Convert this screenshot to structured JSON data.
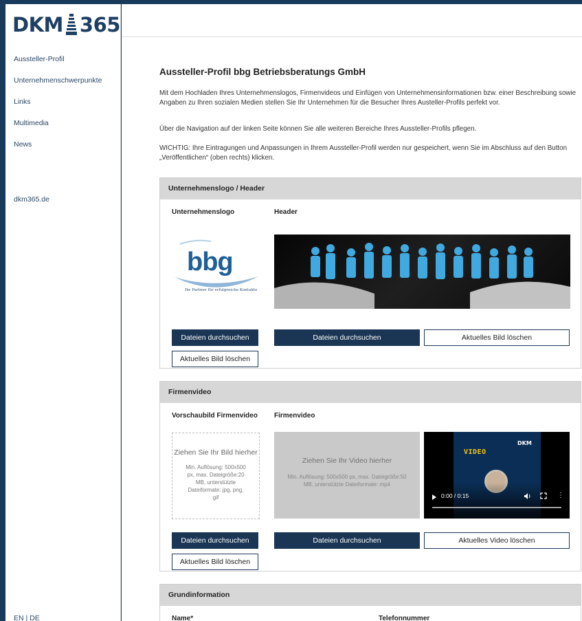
{
  "brand": {
    "logo_text_left": "DKM",
    "logo_text_right": "365"
  },
  "sidebar": {
    "nav": [
      {
        "label": "Aussteller-Profil"
      },
      {
        "label": "Unternehmenschwerpunkte"
      },
      {
        "label": "Links"
      },
      {
        "label": "Multimedia"
      },
      {
        "label": "News"
      }
    ],
    "site_link": "dkm365.de",
    "language": "EN | DE"
  },
  "page": {
    "title": "Aussteller-Profil bbg Betriebsberatungs GmbH",
    "intro_1": "Mit dem Hochladen Ihres Unternehmenslogos, Firmenvideos und Einfügen von Unternehmensinformationen bzw. einer Beschreibung sowie Angaben zu Ihren sozialen Medien stellen Sie Ihr Unternehmen für die Besucher Ihres Austeller-Profils perfekt vor.",
    "intro_2": "Über die Navigation auf der linken Seite können Sie alle weiteren Bereiche Ihres Aussteller-Profils pflegen.",
    "intro_3": "WICHTIG: Ihre Eintragungen und Anpassungen in Ihrem Aussteller-Profil werden nur gespeichert, wenn Sie im Abschluss auf den Button „Veröffentlichen“ (oben rechts) klicken."
  },
  "logo_panel": {
    "heading": "Unternehmenslogo / Header",
    "logo_label": "Unternehmenslogo",
    "header_label": "Header",
    "company_logo_text": "bbg",
    "company_tagline": "Ihr Partner für erfolgreiche Kontakte",
    "browse_label": "Dateien durchsuchen",
    "delete_image_label": "Aktuelles Bild löschen"
  },
  "video_panel": {
    "heading": "Firmenvideo",
    "thumb_label": "Vorschaubild Firmenvideo",
    "video_label": "Firmenvideo",
    "image_drop_title": "Ziehen Sie Ihr Bild hierher",
    "image_drop_hint": "Min. Auflösung: 500x500 px, max. Dateigröße:20 MB, unterstützte Dateiformate: jpg, png, gif",
    "video_drop_title": "Ziehen Sie Ihr Video hierher",
    "video_drop_hint": "Min. Auflösung: 500x500 px, max. Dateigröße:50 MB, unterstützte Dateiformate: mp4",
    "browse_label": "Dateien durchsuchen",
    "delete_image_label": "Aktuelles Bild löschen",
    "delete_video_label": "Aktuelles Video löschen",
    "player": {
      "brand": "DKM",
      "title": "VIDEO",
      "time": "0:00 / 0:15"
    }
  },
  "basic_panel": {
    "heading": "Grundinformation",
    "name_label": "Name*",
    "phone_label": "Telefonnummer"
  },
  "colors": {
    "navy": "#1a3654",
    "frame": "#193a5a",
    "panel_head": "#d7d7d7"
  }
}
